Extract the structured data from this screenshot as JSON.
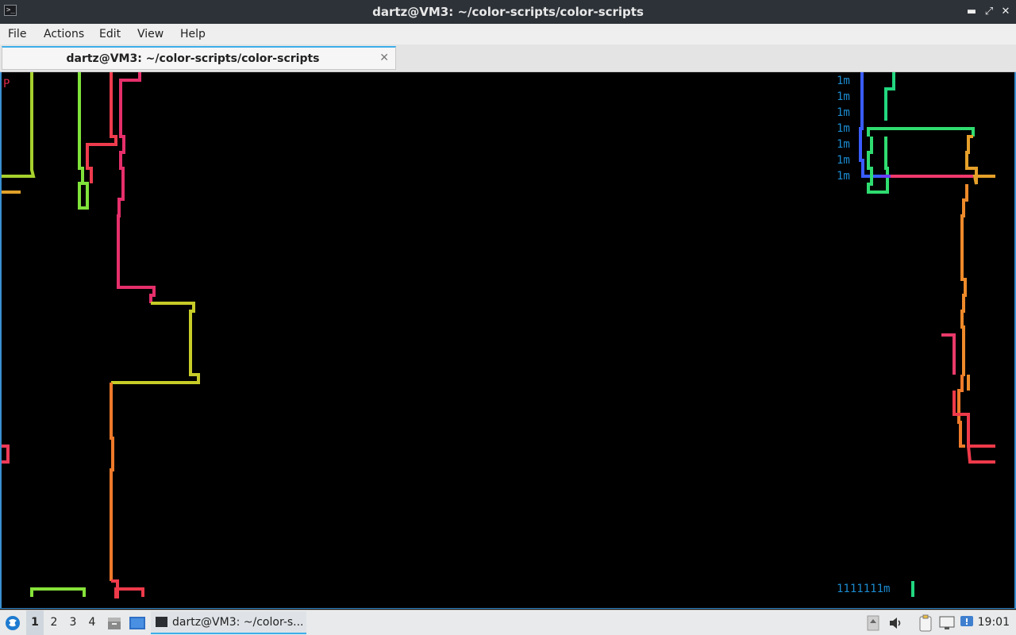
{
  "window": {
    "title": "dartz@VM3: ~/color-scripts/color-scripts",
    "terminal_icon": "terminal-icon",
    "controls": {
      "minimize": "▬",
      "maximize": "⤢",
      "close": "✕"
    }
  },
  "menu": {
    "file": "File",
    "actions": "Actions",
    "edit": "Edit",
    "view": "View",
    "help": "Help"
  },
  "tab": {
    "label": "dartz@VM3: ~/color-scripts/color-scripts",
    "close": "✕"
  },
  "terminal": {
    "top_left_glyph": "P",
    "right_lines": [
      "1m",
      "1m",
      "1m",
      "1m",
      "1m",
      "1m",
      "1m"
    ],
    "bottom_line": "1111111m",
    "colors": {
      "background": "#000000",
      "text": "#1b8bd0",
      "border": "#3a8fd0"
    }
  },
  "taskbar": {
    "start_icon": "distro-logo-icon",
    "workspaces": [
      "1",
      "2",
      "3",
      "4"
    ],
    "task_label": "dartz@VM3: ~/color-s...",
    "clock": "19:01",
    "tray_icons": [
      "scroll-up-icon",
      "volume-icon",
      "clipboard-icon",
      "network-icon",
      "update-notifier-icon"
    ]
  }
}
